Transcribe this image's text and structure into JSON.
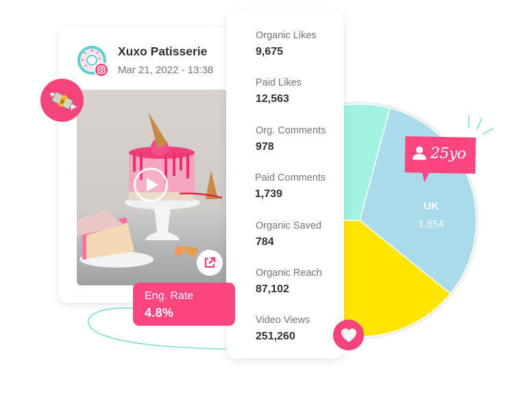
{
  "post": {
    "account_name": "Xuxo Patisserie",
    "date": "Mar 21, 2022 - 13:38",
    "platform_icon": "instagram-icon",
    "avatar_icon": "donut-icon",
    "media_type": "video",
    "media_icon": "play-icon",
    "open_icon": "external-link-icon"
  },
  "badges": {
    "money_icon": "money-with-wings-icon",
    "heart_icon": "heart-icon"
  },
  "engagement": {
    "label": "Eng. Rate",
    "value": "4.8%"
  },
  "stats": [
    {
      "label": "Organic Likes",
      "value": "9,675"
    },
    {
      "label": "Paid Likes",
      "value": "12,563"
    },
    {
      "label": "Org. Comments",
      "value": "978"
    },
    {
      "label": "Paid Comments",
      "value": "1,739"
    },
    {
      "label": "Organic Saved",
      "value": "784"
    },
    {
      "label": "Organic Reach",
      "value": "87,102"
    },
    {
      "label": "Video Views",
      "value": "251,260"
    }
  ],
  "audience_tooltip": {
    "icon": "person-icon",
    "text": "25yo"
  },
  "colors": {
    "accent_pink": "#fd4580",
    "pie_mint": "#a1f2e0",
    "pie_blue": "#a9dbeb",
    "pie_yellow": "#ffe500",
    "orbit_teal": "#7ee0c8"
  },
  "chart_data": {
    "type": "pie",
    "title": "",
    "note": "Pie is partially hidden behind the stats card; only the slices and labels below are visible in the screenshot.",
    "slices": [
      {
        "label": null,
        "value": null,
        "color": "#a1f2e0"
      },
      {
        "label": "UK",
        "value": 1654,
        "display_value": "1,654",
        "color": "#a9dbeb"
      },
      {
        "label": null,
        "value": null,
        "color": "#ffe500"
      }
    ]
  }
}
